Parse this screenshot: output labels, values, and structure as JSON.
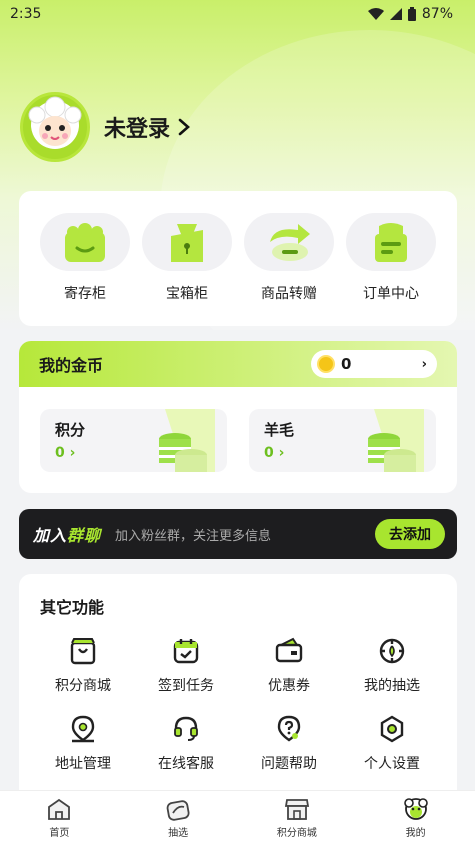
{
  "status_bar": {
    "time": "2:35",
    "battery": "87%"
  },
  "profile": {
    "name": "未登录"
  },
  "quick_actions": [
    {
      "label": "寄存柜",
      "icon": "locker-icon"
    },
    {
      "label": "宝箱柜",
      "icon": "treasure-box-icon"
    },
    {
      "label": "商品转赠",
      "icon": "transfer-gift-icon"
    },
    {
      "label": "订单中心",
      "icon": "order-icon"
    }
  ],
  "coins": {
    "title": "我的金币",
    "balance": "0",
    "points": {
      "title": "积分",
      "value": "0"
    },
    "wool": {
      "title": "羊毛",
      "value": "0"
    }
  },
  "banner": {
    "logo_a": "加入",
    "logo_b": "群聊",
    "text": "加入粉丝群，关注更多信息",
    "button": "去添加"
  },
  "functions": {
    "title": "其它功能",
    "items": [
      {
        "label": "积分商城",
        "icon": "points-mall-icon"
      },
      {
        "label": "签到任务",
        "icon": "checkin-calendar-icon"
      },
      {
        "label": "优惠券",
        "icon": "coupon-icon"
      },
      {
        "label": "我的抽选",
        "icon": "lottery-icon"
      },
      {
        "label": "地址管理",
        "icon": "location-icon"
      },
      {
        "label": "在线客服",
        "icon": "headset-icon"
      },
      {
        "label": "问题帮助",
        "icon": "help-icon"
      },
      {
        "label": "个人设置",
        "icon": "settings-icon"
      }
    ]
  },
  "tabbar": [
    {
      "label": "首页",
      "icon": "home-icon"
    },
    {
      "label": "抽选",
      "icon": "draw-icon"
    },
    {
      "label": "积分商城",
      "icon": "store-icon"
    },
    {
      "label": "我的",
      "icon": "profile-icon"
    }
  ],
  "colors": {
    "accent": "#a8e52f",
    "accent_dark": "#6dbf1f",
    "banner_bg": "#1d1d1f"
  }
}
